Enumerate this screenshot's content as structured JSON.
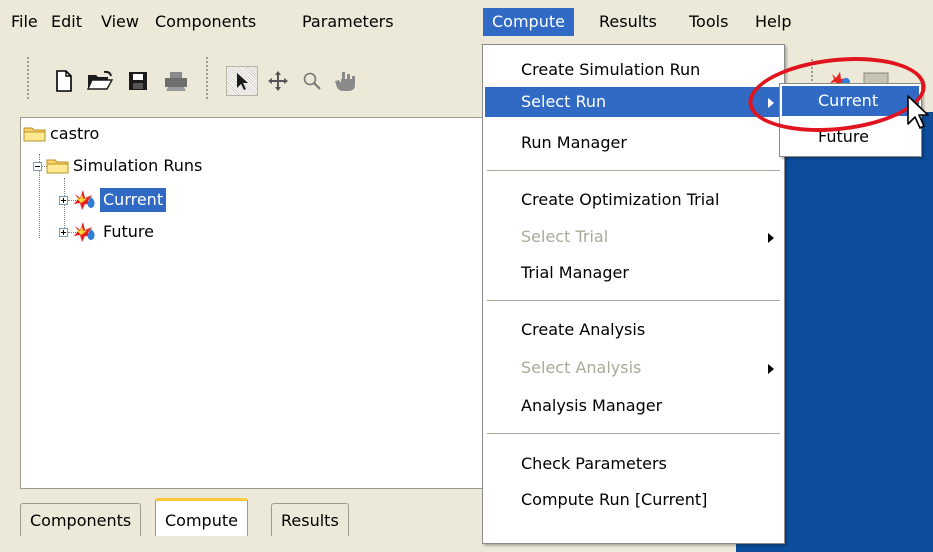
{
  "menubar": {
    "items": [
      {
        "label": "File"
      },
      {
        "label": "Edit"
      },
      {
        "label": "View"
      },
      {
        "label": "Components"
      },
      {
        "label": "Parameters"
      },
      {
        "label": "Compute"
      },
      {
        "label": "Results"
      },
      {
        "label": "Tools"
      },
      {
        "label": "Help"
      }
    ],
    "active": "Compute"
  },
  "toolbar": {
    "buttons": [
      "new-file-icon",
      "open-folder-icon",
      "save-icon",
      "print-icon",
      "select-pointer-icon",
      "move-icon",
      "zoom-icon",
      "pan-hand-icon"
    ],
    "pressed": "select-pointer-icon"
  },
  "tree": {
    "root": {
      "label": "castro"
    },
    "group": {
      "label": "Simulation Runs"
    },
    "runs": [
      {
        "label": "Current",
        "selected": true
      },
      {
        "label": "Future",
        "selected": false
      }
    ]
  },
  "tabs": [
    {
      "label": "Components"
    },
    {
      "label": "Compute",
      "active": true
    },
    {
      "label": "Results"
    }
  ],
  "compute_menu": {
    "items": [
      {
        "label": "Create Simulation Run"
      },
      {
        "label": "Select Run",
        "highlighted": true,
        "submenu": true
      },
      {
        "label": "Run Manager"
      },
      {
        "label": "Create Optimization Trial"
      },
      {
        "label": "Select Trial",
        "disabled": true,
        "submenu": true
      },
      {
        "label": "Trial Manager"
      },
      {
        "label": "Create Analysis"
      },
      {
        "label": "Select Analysis",
        "disabled": true,
        "submenu": true
      },
      {
        "label": "Analysis Manager"
      },
      {
        "label": "Check Parameters"
      },
      {
        "label": "Compute Run [Current]"
      }
    ]
  },
  "select_run_submenu": {
    "items": [
      {
        "label": "Current",
        "highlighted": true
      },
      {
        "label": "Future"
      }
    ]
  },
  "colors": {
    "menu_highlight": "#316ac5",
    "background": "#ece9d8",
    "right_pane": "#0c4e9c",
    "callout": "#e0141e",
    "tab_accent": "#ffc83c"
  }
}
